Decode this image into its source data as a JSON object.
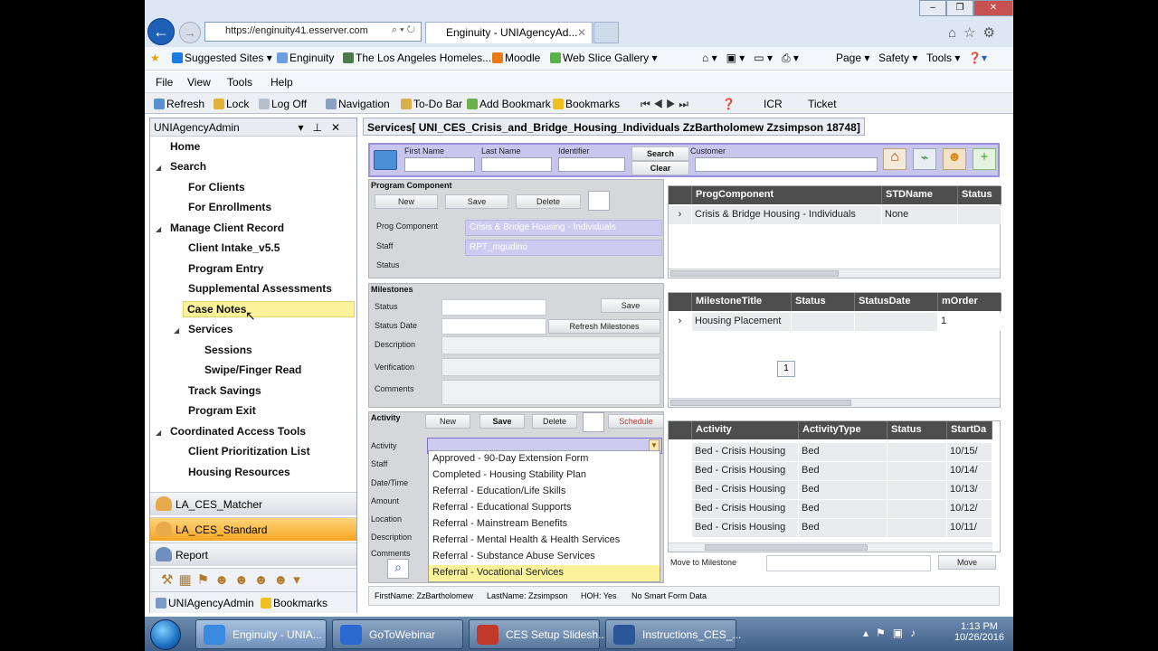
{
  "browser": {
    "url": "https://enginuity41.esserver.com",
    "tab_title": "Enginuity - UNIAgencyAd...",
    "favorites": [
      "Suggested Sites",
      "Enginuity",
      "The Los Angeles Homeles...",
      "Moodle",
      "Web Slice Gallery"
    ],
    "fav_right": [
      "Page",
      "Safety",
      "Tools"
    ],
    "menu": [
      "File",
      "View",
      "Tools",
      "Help"
    ],
    "commands": [
      "Refresh",
      "Lock",
      "Log Off",
      "Navigation",
      "To-Do Bar",
      "Add Bookmark",
      "Bookmarks",
      "ICR",
      "Ticket"
    ]
  },
  "left_panel": {
    "title": "UNIAgencyAdmin",
    "tree": [
      {
        "label": "Home"
      },
      {
        "label": "Search"
      },
      {
        "label": "For Clients"
      },
      {
        "label": "For Enrollments"
      },
      {
        "label": "Manage Client Record"
      },
      {
        "label": "Client Intake_v5.5"
      },
      {
        "label": "Program Entry"
      },
      {
        "label": "Supplemental Assessments"
      },
      {
        "label": "Case Notes"
      },
      {
        "label": "Services"
      },
      {
        "label": "Sessions"
      },
      {
        "label": "Swipe/Finger Read"
      },
      {
        "label": "Track Savings"
      },
      {
        "label": "Program Exit"
      },
      {
        "label": "Coordinated Access Tools"
      },
      {
        "label": "Client Prioritization List"
      },
      {
        "label": "Housing Resources"
      }
    ],
    "accordion": [
      "LA_CES_Matcher",
      "LA_CES_Standard",
      "Report"
    ],
    "bottom_tabs": [
      "UNIAgencyAdmin",
      "Bookmarks"
    ]
  },
  "main": {
    "title": "Services[ UNI_CES_Crisis_and_Bridge_Housing_Individuals ZzBartholomew Zzsimpson 18748]",
    "search": {
      "first_name": "First Name",
      "last_name": "Last Name",
      "identifier": "Identifier",
      "customer": "Customer",
      "search_btn": "Search",
      "clear_btn": "Clear"
    },
    "program_component": {
      "title": "Program Component",
      "buttons": [
        "New",
        "Save",
        "Delete"
      ],
      "labels": [
        "Prog Component",
        "Staff",
        "Status"
      ],
      "prog_value": "Crisis & Bridge Housing - Individuals",
      "staff_value": "RPT_mgudino",
      "grid_headers": [
        "ProgComponent",
        "STDName",
        "Status"
      ],
      "grid_row": [
        "Crisis & Bridge Housing - Individuals",
        "None",
        ""
      ]
    },
    "milestones": {
      "title": "Milestones",
      "labels": [
        "Status",
        "Status Date",
        "Description",
        "Verification",
        "Comments"
      ],
      "save_btn": "Save",
      "refresh_btn": "Refresh Milestones",
      "grid_headers": [
        "MilestoneTitle",
        "Status",
        "StatusDate",
        "mOrder"
      ],
      "grid_row": [
        "Housing Placement",
        "",
        "",
        "1"
      ],
      "page": "1"
    },
    "activity": {
      "title": "Activity",
      "buttons": [
        "New",
        "Save",
        "Delete"
      ],
      "schedule_btn": "Schedule",
      "labels": [
        "Activity",
        "Staff",
        "Date/Time",
        "Amount",
        "Location",
        "Description",
        "Comments"
      ],
      "dropdown": [
        "Approved - 90-Day Extension Form",
        "Completed - Housing Stability Plan",
        "Referral - Education/Life Skills",
        "Referral - Educational Supports",
        "Referral - Mainstream Benefits",
        "Referral - Mental Health & Health Services",
        "Referral - Substance Abuse Services",
        "Referral - Vocational Services"
      ],
      "grid_headers": [
        "Activity",
        "ActivityType",
        "Status",
        "StartDa"
      ],
      "grid_rows": [
        [
          "Bed - Crisis Housing",
          "Bed",
          "",
          "10/15/"
        ],
        [
          "Bed - Crisis Housing",
          "Bed",
          "",
          "10/14/"
        ],
        [
          "Bed - Crisis Housing",
          "Bed",
          "",
          "10/13/"
        ],
        [
          "Bed - Crisis Housing",
          "Bed",
          "",
          "10/12/"
        ],
        [
          "Bed - Crisis Housing",
          "Bed",
          "",
          "10/11/"
        ]
      ],
      "move_label": "Move to Milestone",
      "move_btn": "Move"
    },
    "status_line": [
      "FirstName: ZzBartholomew",
      "LastName: Zzsimpson",
      "HOH: Yes",
      "No Smart Form Data"
    ]
  },
  "taskbar": {
    "tasks": [
      "Enginuity - UNIA...",
      "GoToWebinar",
      "CES Setup Slidesh...",
      "Instructions_CES_..."
    ],
    "time": "1:13 PM",
    "date": "10/26/2016"
  }
}
